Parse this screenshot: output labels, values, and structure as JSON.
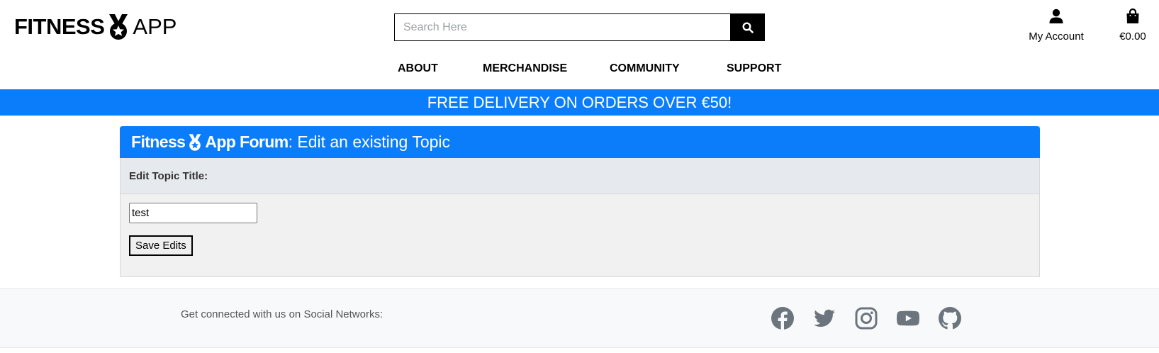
{
  "header": {
    "logo_bold": "FITNESS",
    "logo_light": "APP",
    "search_placeholder": "Search Here",
    "account_label": "My Account",
    "bag_total": "€0.00"
  },
  "nav": [
    {
      "label": "ABOUT"
    },
    {
      "label": "MERCHANDISE"
    },
    {
      "label": "COMMUNITY"
    },
    {
      "label": "SUPPORT"
    }
  ],
  "promo": "FREE DELIVERY ON ORDERS OVER €50!",
  "forum": {
    "brand_left": "Fitness",
    "brand_right": "App Forum",
    "subtitle": ": Edit an existing Topic",
    "field_label": "Edit Topic Title:",
    "field_value": "test",
    "save_label": "Save Edits"
  },
  "footer": {
    "text": "Get connected with us on Social Networks:",
    "icons": [
      "facebook-icon",
      "twitter-icon",
      "instagram-icon",
      "youtube-icon",
      "github-icon"
    ]
  },
  "colors": {
    "accent": "#0b7dfb",
    "footer_icon": "#6c757d"
  }
}
